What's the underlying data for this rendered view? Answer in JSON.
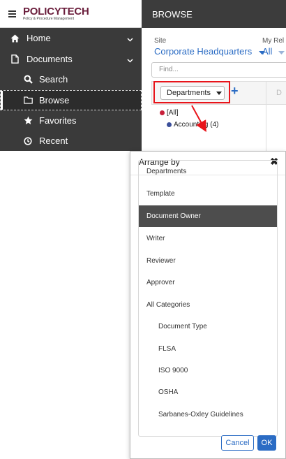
{
  "brand": {
    "logo": "POLICYTECH",
    "tagline": "Policy & Procedure Management"
  },
  "sidebar": {
    "items": [
      {
        "label": "Home",
        "icon": "home-icon"
      },
      {
        "label": "Documents",
        "icon": "document-icon"
      },
      {
        "label": "Search",
        "icon": "search-icon"
      },
      {
        "label": "Browse",
        "icon": "folder-icon"
      },
      {
        "label": "Favorites",
        "icon": "star-icon"
      },
      {
        "label": "Recent",
        "icon": "clock-icon"
      }
    ]
  },
  "header": {
    "title": "BROWSE"
  },
  "filters": {
    "site_label": "Site",
    "site_value": "Corporate Headquarters",
    "my_label": "My Rel",
    "my_value": "All"
  },
  "find": {
    "placeholder": "Find..."
  },
  "tree": {
    "arrange_button": "Departments",
    "column_letter": "D",
    "items": [
      {
        "label": "[All]",
        "color": "#c8203b"
      },
      {
        "label": "Accounting (4)",
        "color": "#3b4f9a"
      }
    ]
  },
  "dialog": {
    "title": "Arrange by",
    "options": [
      {
        "label": "Departments",
        "selected": false,
        "kind": "top"
      },
      {
        "label": "Template",
        "selected": false,
        "kind": "top"
      },
      {
        "label": "Document Owner",
        "selected": true,
        "kind": "top"
      },
      {
        "label": "Writer",
        "selected": false,
        "kind": "top"
      },
      {
        "label": "Reviewer",
        "selected": false,
        "kind": "top"
      },
      {
        "label": "Approver",
        "selected": false,
        "kind": "top"
      },
      {
        "label": "All Categories",
        "selected": false,
        "kind": "category"
      },
      {
        "label": "Document Type",
        "selected": false,
        "kind": "sub"
      },
      {
        "label": "FLSA",
        "selected": false,
        "kind": "sub"
      },
      {
        "label": "ISO 9000",
        "selected": false,
        "kind": "sub"
      },
      {
        "label": "OSHA",
        "selected": false,
        "kind": "sub"
      },
      {
        "label": "Sarbanes-Oxley Guidelines",
        "selected": false,
        "kind": "sub"
      }
    ],
    "cancel_label": "Cancel",
    "ok_label": "OK"
  },
  "colors": {
    "accent": "#2b6cc4",
    "sidebar_bg": "#3a3a3a",
    "selected_bg": "#4d4d4d",
    "highlight_red": "#e8141a",
    "brand": "#6a1d3b"
  }
}
